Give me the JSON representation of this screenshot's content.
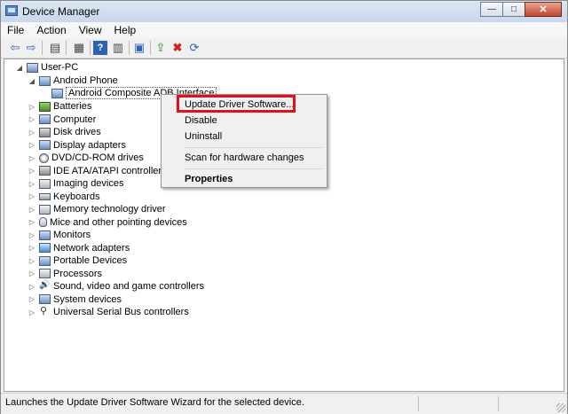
{
  "window": {
    "title": "Device Manager"
  },
  "menu": [
    "File",
    "Action",
    "View",
    "Help"
  ],
  "toolbar": [
    "back-icon",
    "forward-icon",
    "console-tree-icon",
    "properties-icon",
    "help-icon",
    "device-list-icon",
    "computer-icon",
    "update-driver-icon",
    "uninstall-icon",
    "scan-hardware-icon"
  ],
  "tree": {
    "root": "User-PC",
    "android_phone": "Android Phone",
    "adb_interface": "Android Composite ADB Interface",
    "categories": [
      {
        "label": "Batteries",
        "icon": "battery"
      },
      {
        "label": "Computer",
        "icon": "pc"
      },
      {
        "label": "Disk drives",
        "icon": "disk"
      },
      {
        "label": "Display adapters",
        "icon": "pc"
      },
      {
        "label": "DVD/CD-ROM drives",
        "icon": "cdrom"
      },
      {
        "label": "IDE ATA/ATAPI controllers",
        "icon": "disk"
      },
      {
        "label": "Imaging devices",
        "icon": "hid"
      },
      {
        "label": "Keyboards",
        "icon": "keyboard"
      },
      {
        "label": "Memory technology driver",
        "icon": "hid"
      },
      {
        "label": "Mice and other pointing devices",
        "icon": "mouse"
      },
      {
        "label": "Monitors",
        "icon": "pc"
      },
      {
        "label": "Network adapters",
        "icon": "net"
      },
      {
        "label": "Portable Devices",
        "icon": "pc"
      },
      {
        "label": "Processors",
        "icon": "hid"
      },
      {
        "label": "Sound, video and game controllers",
        "icon": "sound"
      },
      {
        "label": "System devices",
        "icon": "pc"
      },
      {
        "label": "Universal Serial Bus controllers",
        "icon": "usb"
      }
    ]
  },
  "context_menu": {
    "update_driver": "Update Driver Software...",
    "disable": "Disable",
    "uninstall": "Uninstall",
    "scan": "Scan for hardware changes",
    "properties": "Properties"
  },
  "status": {
    "text": "Launches the Update Driver Software Wizard for the selected device."
  },
  "colors": {
    "highlight_border": "#e0101a",
    "title_bar": "#c8d8ec"
  }
}
